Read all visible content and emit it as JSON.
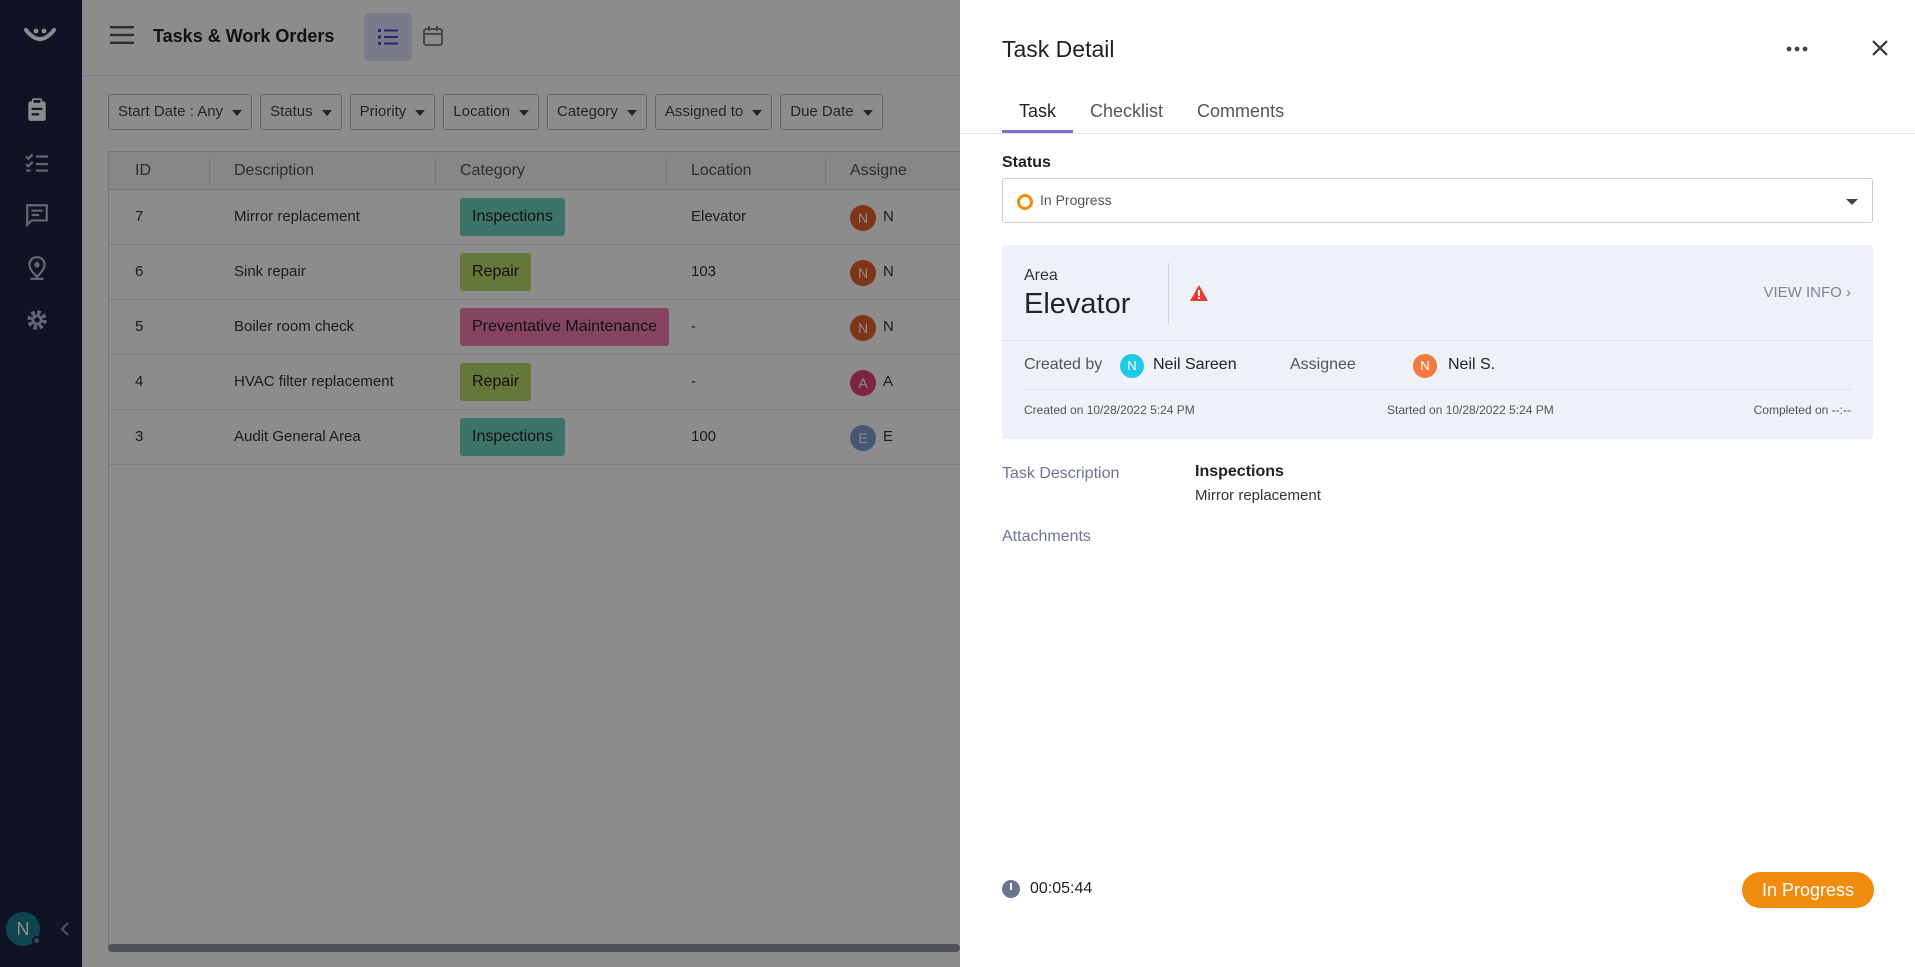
{
  "main": {
    "title": "Tasks & Work Orders",
    "filters": [
      "Start Date : Any",
      "Status",
      "Priority",
      "Location",
      "Category",
      "Assigned to",
      "Due Date"
    ],
    "table": {
      "headers": [
        "ID",
        "Description",
        "Category",
        "Location",
        "Assigne"
      ],
      "rows": [
        {
          "id": "7",
          "description": "Mirror replacement",
          "category": "Inspections",
          "category_color": "#6fd3bf",
          "location": "Elevator",
          "assignee_initial": "N",
          "assignee_color": "#e8622c",
          "assignee_trunc": "N"
        },
        {
          "id": "6",
          "description": "Sink repair",
          "category": "Repair",
          "category_color": "#b8db6b",
          "location": "103",
          "assignee_initial": "N",
          "assignee_color": "#e8622c",
          "assignee_trunc": "N"
        },
        {
          "id": "5",
          "description": "Boiler room check",
          "category": "Preventative Maintenance",
          "category_color": "#f27fb0",
          "location": "-",
          "assignee_initial": "N",
          "assignee_color": "#e8622c",
          "assignee_trunc": "N"
        },
        {
          "id": "4",
          "description": "HVAC filter replacement",
          "category": "Repair",
          "category_color": "#b8db6b",
          "location": "-",
          "assignee_initial": "A",
          "assignee_color": "#e0447a",
          "assignee_trunc": "A"
        },
        {
          "id": "3",
          "description": "Audit General Area",
          "category": "Inspections",
          "category_color": "#6fd3bf",
          "location": "100",
          "assignee_initial": "E",
          "assignee_color": "#7f9fd6",
          "assignee_trunc": "E"
        }
      ]
    }
  },
  "sidebar": {
    "icons": [
      "logo-icon",
      "clipboard-icon",
      "checklist-icon",
      "chat-icon",
      "location-pin-icon",
      "gear-icon"
    ],
    "user_initial": "N"
  },
  "panel": {
    "title": "Task Detail",
    "tabs": [
      "Task",
      "Checklist",
      "Comments"
    ],
    "active_tab": "Task",
    "status_label": "Status",
    "status_value": "In Progress",
    "area_label": "Area",
    "area_name": "Elevator",
    "view_info": "VIEW INFO",
    "created_by_label": "Created by",
    "created_by_initial": "N",
    "created_by_name": "Neil Sareen",
    "assignee_label": "Assignee",
    "assignee_initial": "N",
    "assignee_name": "Neil S.",
    "created_on": "Created on 10/28/2022 5:24 PM",
    "started_on": "Started on 10/28/2022 5:24 PM",
    "completed_on": "Completed on --:--",
    "task_description_label": "Task Description",
    "task_description_title": "Inspections",
    "task_description_text": "Mirror replacement",
    "attachments_label": "Attachments",
    "timer": "00:05:44",
    "status_button": "In Progress",
    "colors": {
      "accent": "#7b70d8",
      "in_progress": "#f28c0f",
      "created_by_avatar": "#1ec8e6",
      "assignee_avatar": "#f07a3f",
      "warning": "#e53935"
    }
  }
}
